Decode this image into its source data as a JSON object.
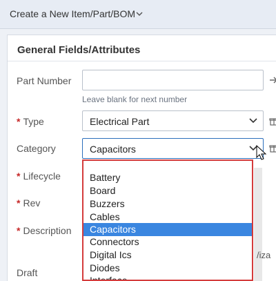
{
  "header": {
    "title": "Create a New Item/Part/BOM"
  },
  "panel": {
    "title": "General Fields/Attributes"
  },
  "fields": {
    "part_number": {
      "label": "Part Number",
      "value": "",
      "hint": "Leave blank for next number"
    },
    "type": {
      "label": "Type",
      "value": "Electrical Part"
    },
    "category": {
      "label": "Category",
      "value": "Capacitors"
    },
    "lifecycle": {
      "label": "Lifecycle"
    },
    "rev": {
      "label": "Rev"
    },
    "description": {
      "label": "Description"
    },
    "draft": {
      "label": "Draft"
    }
  },
  "required_marker": "*",
  "category_options": [
    "Battery",
    "Board",
    "Buzzers",
    "Cables",
    "Capacitors",
    "Connectors",
    "Digital Ics",
    "Diodes",
    "Interface"
  ],
  "category_selected": "Capacitors",
  "partial_right_text": "/iza",
  "colors": {
    "accent": "#3a86e0",
    "highlight_border": "#d43b3b",
    "required": "#c62828"
  }
}
